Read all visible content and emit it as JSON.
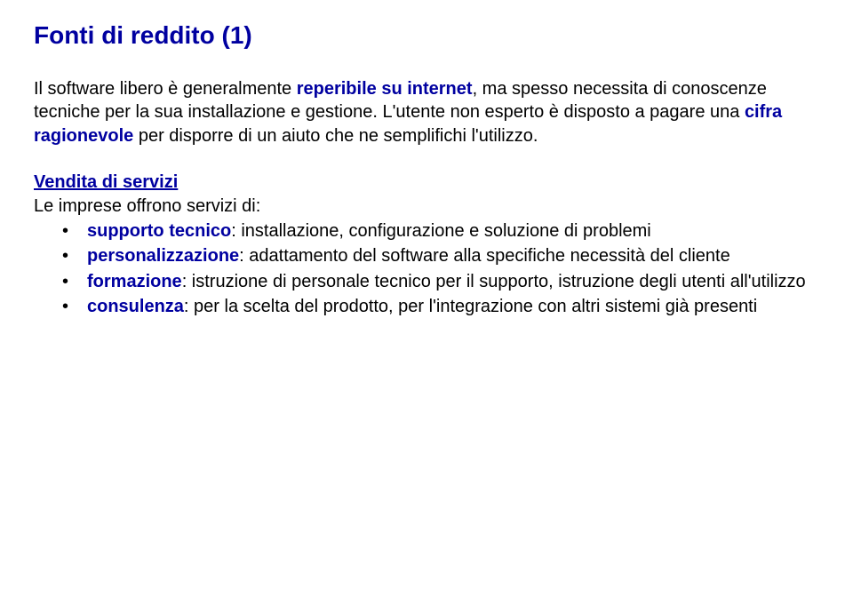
{
  "title": "Fonti di reddito (1)",
  "para1": {
    "seg1": "Il  software libero è generalmente ",
    "k1": "reperibile su internet",
    "seg2": ", ma spesso necessita di conoscenze tecniche per la sua installazione e gestione. L'utente non esperto è disposto a pagare una ",
    "k2": "cifra ragionevole",
    "seg3": " per disporre di un aiuto che ne semplifichi l'utilizzo."
  },
  "section": {
    "heading": "Vendita di servizi",
    "lead": "Le imprese offrono servizi di:"
  },
  "bullets": [
    {
      "key": "supporto tecnico",
      "rest": ": installazione, configurazione e soluzione di problemi"
    },
    {
      "key": "personalizzazione",
      "rest": ": adattamento del software alla specifiche necessità del cliente"
    },
    {
      "key": "formazione",
      "rest": ": istruzione di personale tecnico per il supporto, istruzione degli utenti  all'utilizzo"
    },
    {
      "key": "consulenza",
      "rest": ":  per la scelta del prodotto, per l'integrazione con altri sistemi già presenti"
    }
  ]
}
